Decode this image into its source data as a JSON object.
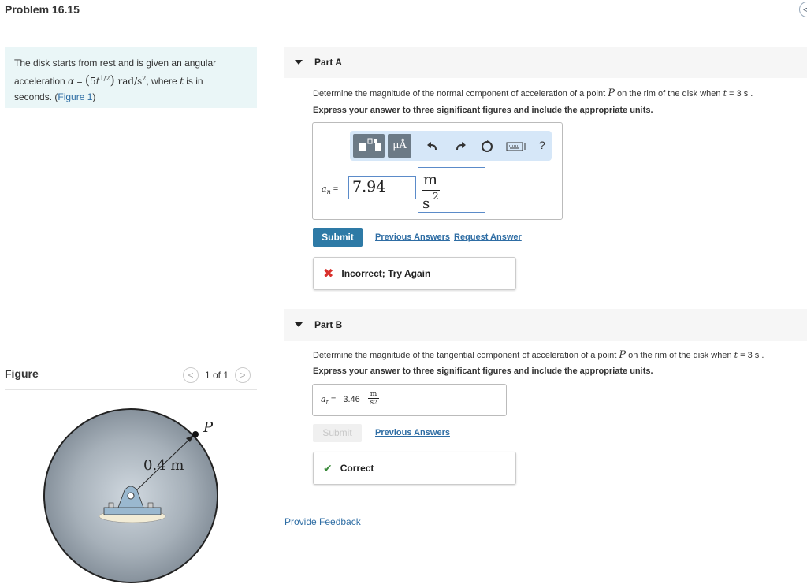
{
  "header": {
    "title": "Problem 16.15",
    "nav_icon": "<"
  },
  "problem": {
    "text_1": "The disk starts from rest and is given an angular",
    "text_2a": "acceleration ",
    "alpha": "α",
    "eq": " = ",
    "expr_open": "(",
    "expr_base": "5",
    "expr_t": "t",
    "expr_exp": "1/2",
    "expr_close": ")",
    "units": " rad/s",
    "units_exp": "2",
    "text_2b": ", where ",
    "t_var": "t",
    "text_2c": " is in",
    "text_3": "seconds. (",
    "figure_link": "Figure 1",
    "text_3b": ")"
  },
  "figure": {
    "label": "Figure",
    "pager": {
      "prev": "<",
      "text": "1 of 1",
      "next": ">"
    },
    "dimension_label": "0.4 m",
    "point_label": "P"
  },
  "partA": {
    "title": "Part A",
    "question_pre": "Determine the magnitude of the normal component of acceleration of a point ",
    "question_P": "P",
    "question_mid": " on the rim of the disk when ",
    "question_t": "t",
    "question_post": " = 3 s .",
    "instruction": "Express your answer to three significant figures and include the appropriate units.",
    "toolbar": {
      "mu_label": "μÅ",
      "help_label": "?"
    },
    "var_label": "a",
    "var_sub": "n",
    "var_eq": " =",
    "value": "7.94",
    "unit_num": "m",
    "unit_den": "s",
    "unit_exp": "2",
    "submit": "Submit",
    "previous_answers": "Previous Answers",
    "request_answer": "Request Answer",
    "feedback": "Incorrect; Try Again"
  },
  "partB": {
    "title": "Part B",
    "question_pre": "Determine the magnitude of the tangential component of acceleration of a point ",
    "question_P": "P",
    "question_mid": " on the rim of the disk when ",
    "question_t": "t",
    "question_post": " = 3 s .",
    "instruction": "Express your answer to three significant figures and include the appropriate units.",
    "var_label": "a",
    "var_sub": "t",
    "var_eq": " =",
    "value": "3.46",
    "unit_num": "m",
    "unit_den": "s",
    "unit_exp": "2",
    "submit": "Submit",
    "previous_answers": "Previous Answers",
    "feedback": "Correct"
  },
  "footer": {
    "provide_feedback": "Provide Feedback"
  },
  "colors": {
    "accent": "#2e7aa6",
    "link": "#2e6da4",
    "error": "#d9302c",
    "success": "#3a8a3a",
    "problem_bg": "#eaf6f7"
  }
}
